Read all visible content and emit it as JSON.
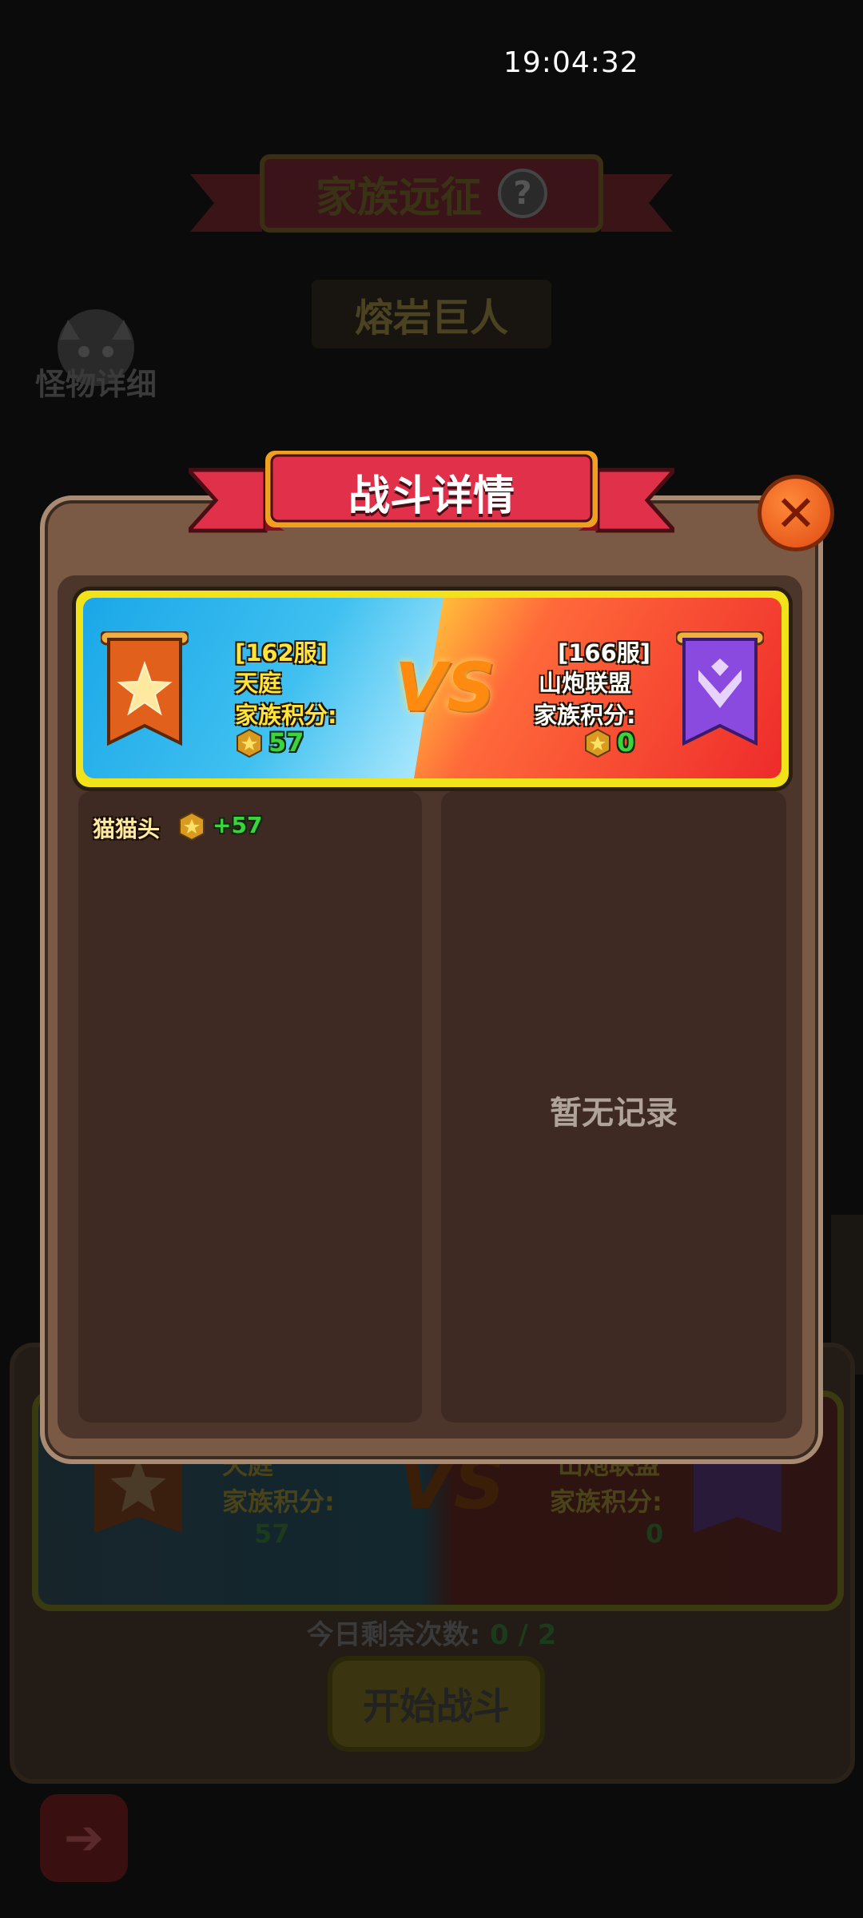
{
  "status_bar": {
    "time": "19:04:32"
  },
  "background": {
    "title": "家族远征",
    "help_icon": "question-mark-icon",
    "boss_name": "熔岩巨人",
    "monster_detail_label": "怪物详细",
    "card": {
      "left_team": "天庭",
      "left_score_label": "家族积分:",
      "left_score": "57",
      "right_team": "山炮联盟",
      "right_score_label": "家族积分:",
      "right_score": "0",
      "vs": "VS"
    },
    "remaining_label": "今日剩余次数:",
    "remaining_value": "0 / 2",
    "start_button": "开始战斗",
    "back_icon": "back-arrow-icon"
  },
  "modal": {
    "title": "战斗详情",
    "close_icon": "close-x-icon",
    "vs_label": "VS",
    "left_team": {
      "server": "[162服]",
      "name": "天庭",
      "score_label": "家族积分:",
      "score": "57",
      "banner_icon": "orange-star-banner-icon",
      "medal_icon": "star-medal-icon"
    },
    "right_team": {
      "server": "[166服]",
      "name": "山炮联盟",
      "score_label": "家族积分:",
      "score": "0",
      "banner_icon": "purple-wing-banner-icon",
      "medal_icon": "star-medal-icon"
    },
    "left_records": [
      {
        "player": "猫猫头",
        "score": "+57"
      }
    ],
    "right_empty_text": "暂无记录"
  },
  "colors": {
    "modal_frame": "#7a5a45",
    "ribbon_red": "#e0304a",
    "vs_orange": "#ff8a10",
    "score_green": "#3cd43c",
    "card_border_yellow": "#f2e21a"
  }
}
